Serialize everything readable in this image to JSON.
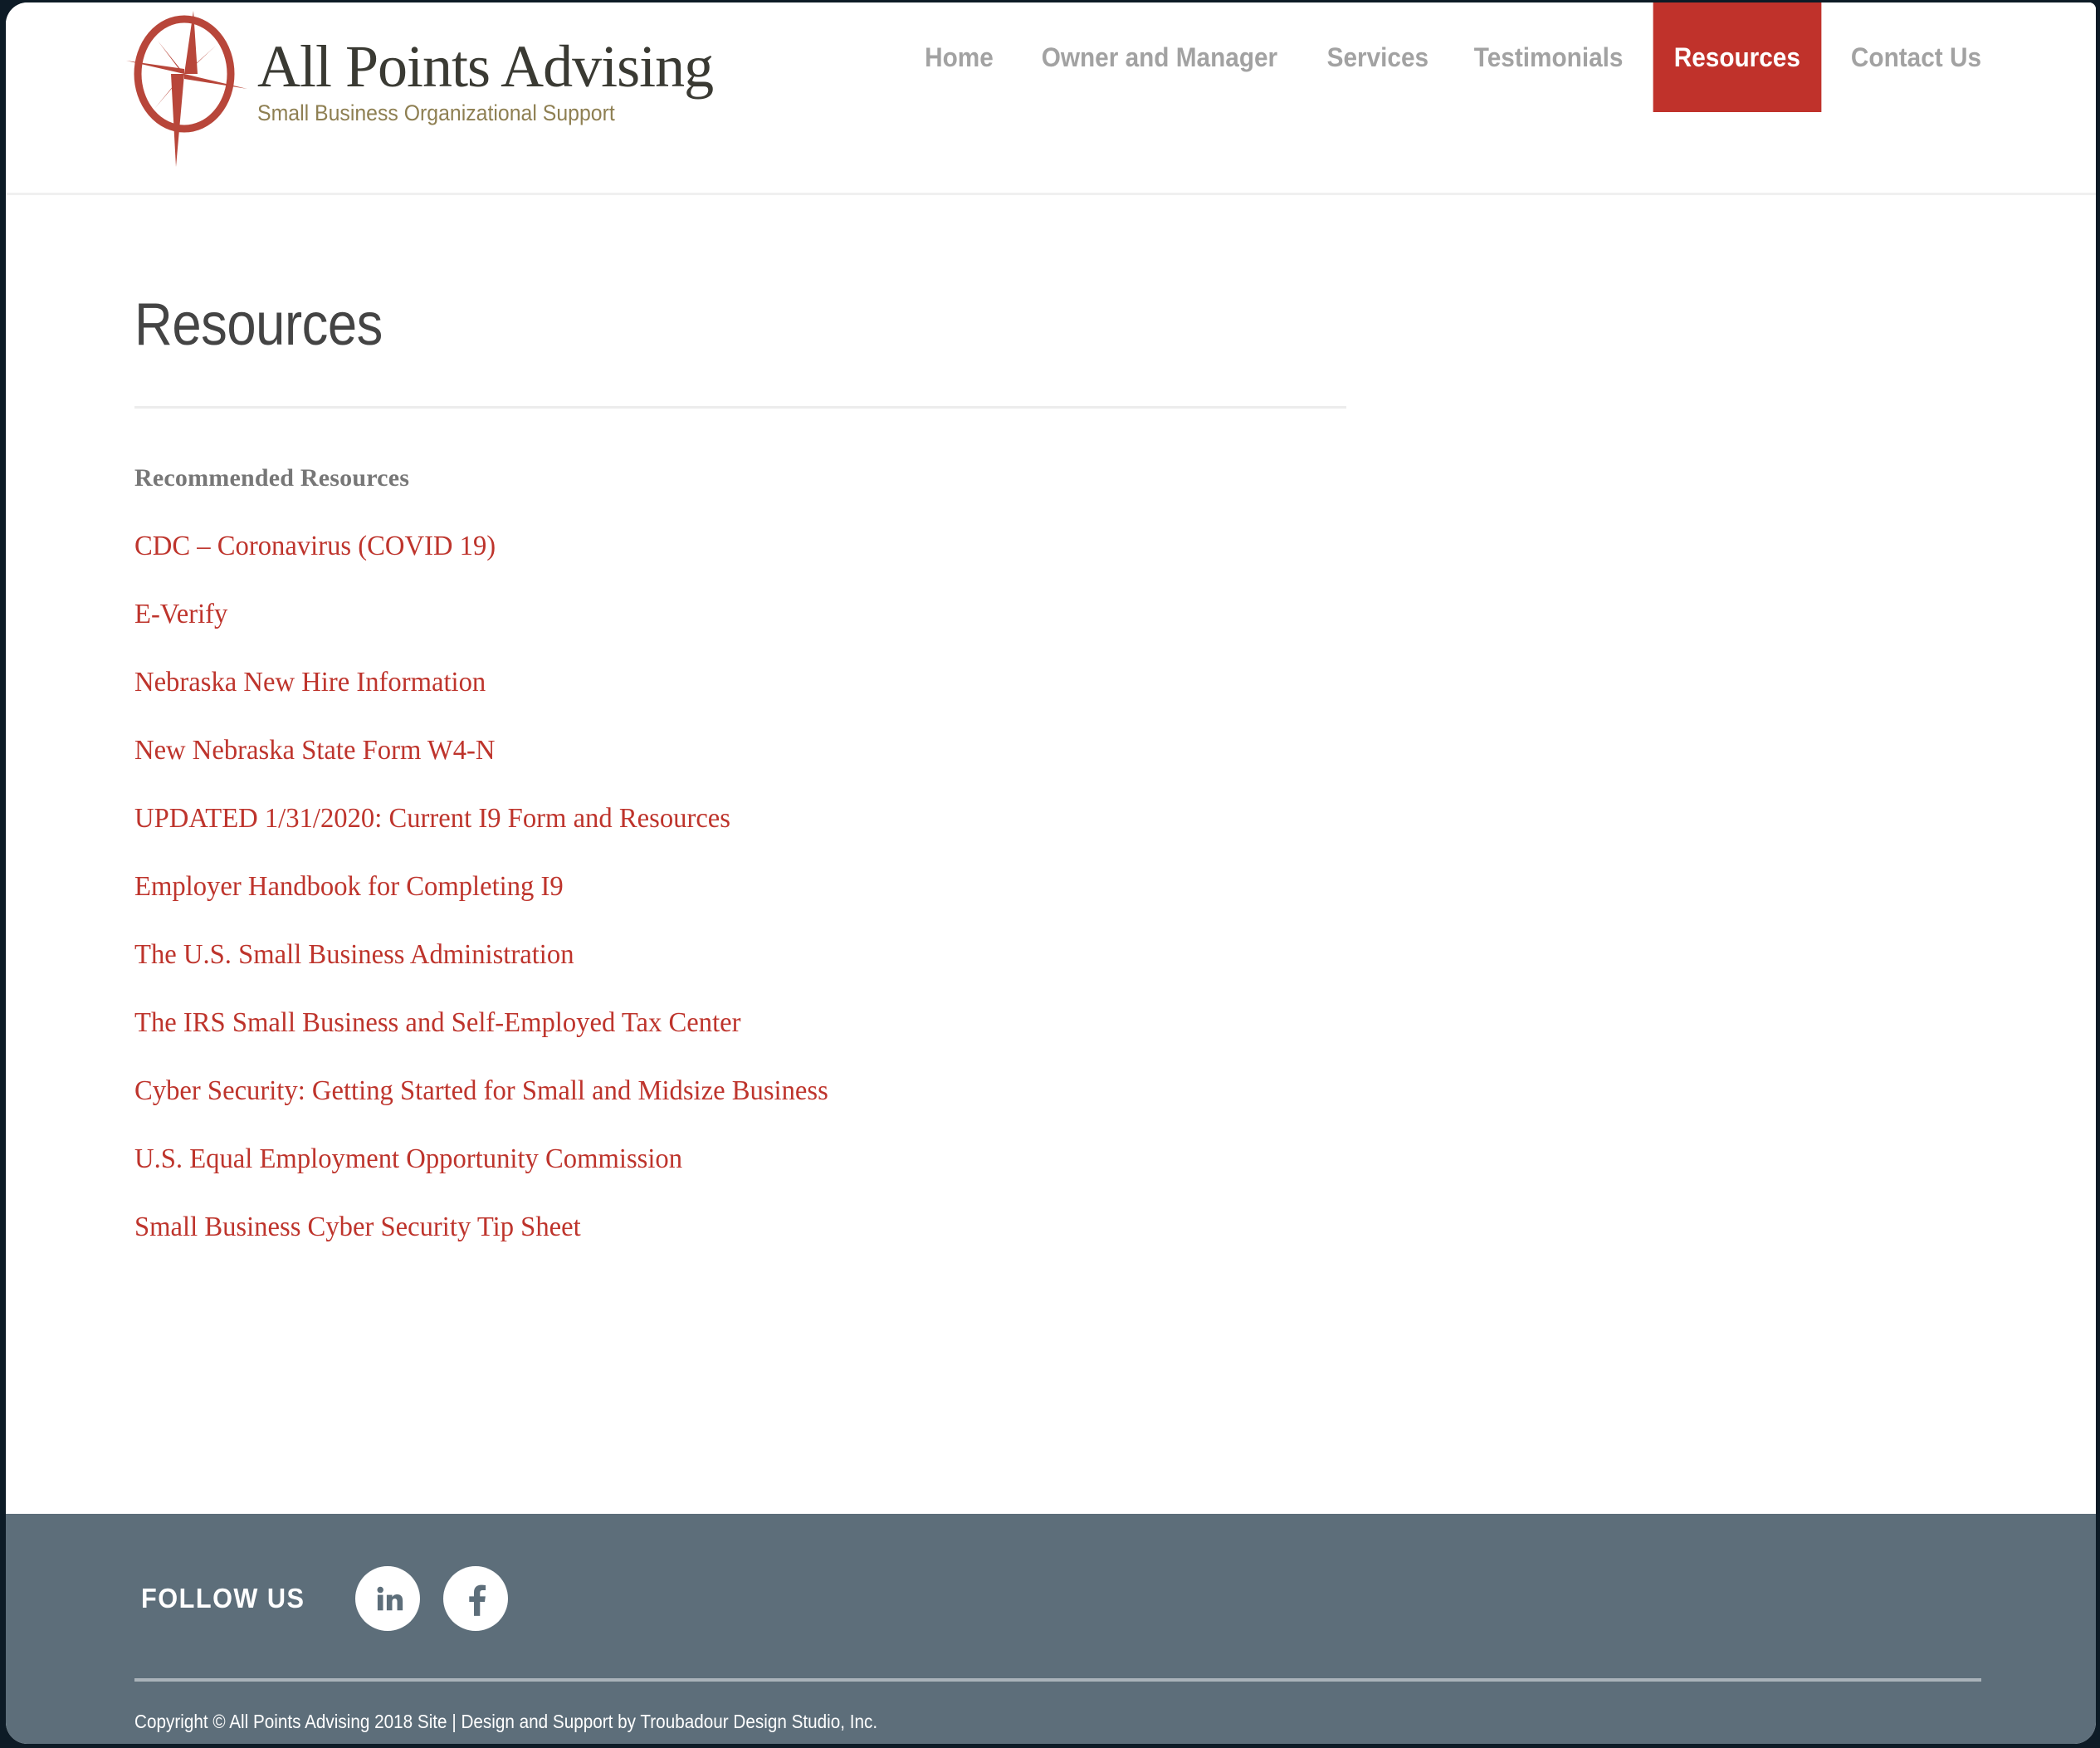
{
  "brand": {
    "title": "All Points Advising",
    "tagline": "Small Business Organizational Support",
    "logo_icon": "compass-rose-icon"
  },
  "nav": {
    "items": [
      {
        "label": "Home",
        "active": false
      },
      {
        "label": "Owner and Manager",
        "active": false
      },
      {
        "label": "Services",
        "active": false
      },
      {
        "label": "Testimonials",
        "active": false
      },
      {
        "label": "Resources",
        "active": true
      },
      {
        "label": "Contact Us",
        "active": false
      }
    ],
    "active_bg": "#c0322b",
    "inactive_color": "#a2a2a2"
  },
  "main": {
    "page_title": "Resources",
    "section_heading": "Recommended Resources",
    "link_color": "#be342c",
    "links": [
      "CDC – Coronavirus (COVID 19)",
      "E-Verify",
      "Nebraska New Hire Information",
      "New Nebraska State Form W4-N",
      "UPDATED 1/31/2020: Current I9 Form and Resources",
      "Employer Handbook for Completing I9",
      "The U.S. Small Business Administration",
      "The IRS Small Business and Self-Employed Tax Center",
      "Cyber Security: Getting Started for Small and Midsize Business",
      "U.S. Equal Employment Opportunity Commission",
      "Small Business Cyber Security Tip Sheet"
    ]
  },
  "footer": {
    "background": "#5d6e7a",
    "follow_label": "FOLLOW US",
    "social": [
      {
        "name": "linkedin-icon",
        "label": "in"
      },
      {
        "name": "facebook-icon",
        "label": "f"
      }
    ],
    "copyright": "Copyright © All Points Advising 2018 Site | Design and Support by Troubadour Design Studio, Inc."
  }
}
